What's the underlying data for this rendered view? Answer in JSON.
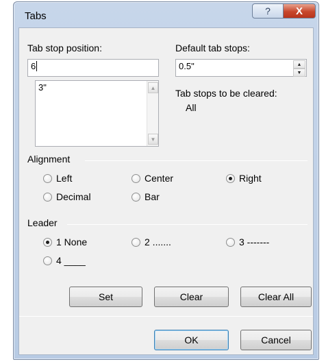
{
  "window": {
    "title": "Tabs"
  },
  "titlebar": {
    "help_glyph": "?",
    "close_glyph": "X"
  },
  "tab_stop_position": {
    "label": "Tab stop position:",
    "value": "6",
    "list": [
      "3\""
    ]
  },
  "default_tab_stops": {
    "label": "Default tab stops:",
    "value": "0.5\""
  },
  "to_be_cleared": {
    "label": "Tab stops to be cleared:",
    "value": "All"
  },
  "alignment": {
    "label": "Alignment",
    "options": [
      {
        "label": "Left",
        "selected": false
      },
      {
        "label": "Center",
        "selected": false
      },
      {
        "label": "Right",
        "selected": true
      },
      {
        "label": "Decimal",
        "selected": false
      },
      {
        "label": "Bar",
        "selected": false
      }
    ]
  },
  "leader": {
    "label": "Leader",
    "options": [
      {
        "label": "1 None",
        "selected": true
      },
      {
        "label": "2 .......",
        "selected": false
      },
      {
        "label": "3 -------",
        "selected": false
      },
      {
        "label": "4 ____",
        "selected": false
      }
    ]
  },
  "buttons": {
    "set": "Set",
    "clear": "Clear",
    "clear_all": "Clear All",
    "ok": "OK",
    "cancel": "Cancel"
  },
  "colors": {
    "title_bar": "#c7d6ea",
    "close_button": "#c7472c",
    "dialog_bg": "#f0f0f0"
  }
}
